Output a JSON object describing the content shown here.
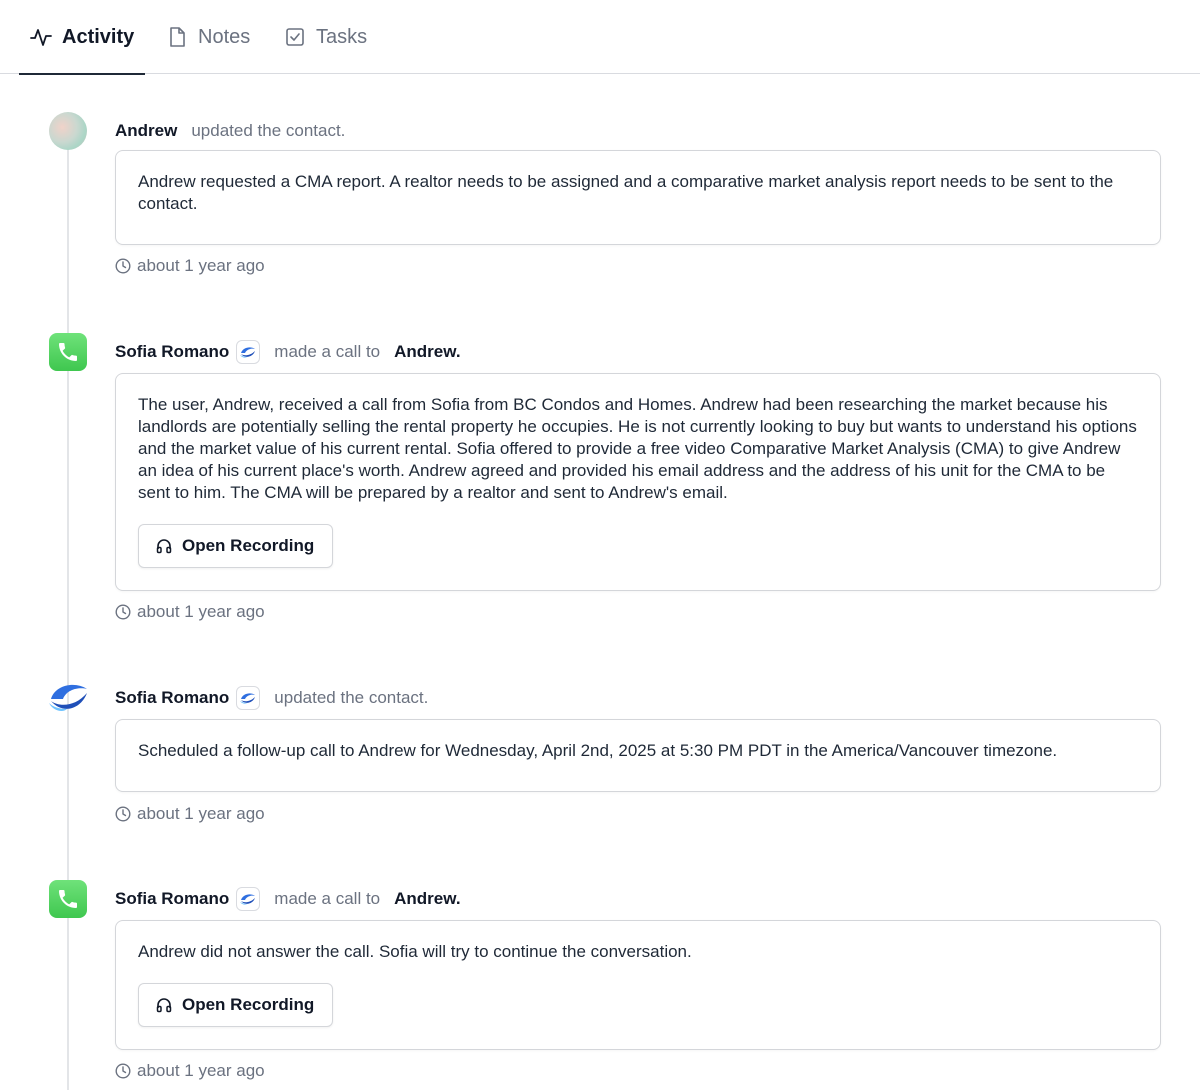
{
  "tabs": [
    {
      "label": "Activity",
      "icon": "activity-icon",
      "active": true
    },
    {
      "label": "Notes",
      "icon": "note-icon",
      "active": false
    },
    {
      "label": "Tasks",
      "icon": "task-checkbox-icon",
      "active": false
    }
  ],
  "colors": {
    "phone_green": "#4cd964",
    "logo_blue": "#2f6fe0",
    "muted": "#6b7280"
  },
  "entries": [
    {
      "avatar": "blurred-user-avatar",
      "actor": "Andrew",
      "action": "updated the contact.",
      "body": "Andrew requested a CMA report. A realtor needs to be assigned and a comparative market analysis report needs to be sent to the contact.",
      "time": "about 1 year ago"
    },
    {
      "avatar": "phone-icon",
      "actor": "Sofia Romano",
      "action": "made a call to",
      "target": "Andrew.",
      "body": "The user, Andrew, received a call from Sofia from BC Condos and Homes. Andrew had been researching the market because his landlords are potentially selling the rental property he occupies. He is not currently looking to buy but wants to understand his options and the market value of his current rental. Sofia offered to provide a free video Comparative Market Analysis (CMA) to give Andrew an idea of his current place's worth. Andrew agreed and provided his email address and the address of his unit for the CMA to be sent to him. The CMA will be prepared by a realtor and sent to Andrew's email.",
      "button": "Open Recording",
      "time": "about 1 year ago"
    },
    {
      "avatar": "company-logo-icon",
      "actor": "Sofia Romano",
      "action": "updated the contact.",
      "body": "Scheduled a follow-up call to Andrew for Wednesday, April 2nd, 2025 at 5:30 PM PDT in the America/Vancouver timezone.",
      "time": "about 1 year ago"
    },
    {
      "avatar": "phone-icon",
      "actor": "Sofia Romano",
      "action": "made a call to",
      "target": "Andrew.",
      "body": "Andrew did not answer the call. Sofia will try to continue the conversation.",
      "button": "Open Recording",
      "time": "about 1 year ago"
    }
  ]
}
